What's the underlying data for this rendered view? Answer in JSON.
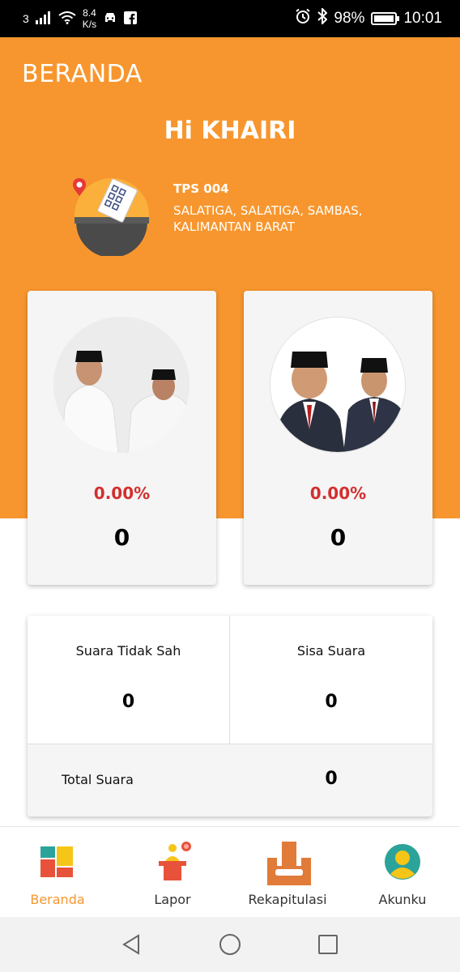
{
  "status_bar": {
    "network": "3",
    "speed_value": "8.4",
    "speed_unit": "K/s",
    "battery_level": "98%",
    "battery_fraction": 0.98,
    "time": "10:01",
    "icons": [
      "signal-icon",
      "wifi-icon",
      "car-icon",
      "facebook-icon",
      "alarm-icon",
      "bluetooth-icon",
      "battery-icon"
    ]
  },
  "header": {
    "title": "BERANDA",
    "greeting": "Hi KHAIRI",
    "tps_name": "TPS 004",
    "tps_location": "SALATIGA, SALATIGA, SAMBAS, KALIMANTAN BARAT",
    "background_color": "#F7962E"
  },
  "candidates": [
    {
      "percent": "0.00%",
      "votes": "0"
    },
    {
      "percent": "0.00%",
      "votes": "0"
    }
  ],
  "summary": {
    "invalid_label": "Suara Tidak Sah",
    "invalid_value": "0",
    "remaining_label": "Sisa Suara",
    "remaining_value": "0",
    "total_label": "Total Suara",
    "total_value": "0"
  },
  "nav": {
    "items": [
      {
        "label": "Beranda",
        "icon": "home-grid-icon",
        "active": true
      },
      {
        "label": "Lapor",
        "icon": "report-podium-icon",
        "active": false
      },
      {
        "label": "Rekapitulasi",
        "icon": "ballot-box-icon",
        "active": false
      },
      {
        "label": "Akunku",
        "icon": "account-icon",
        "active": false
      }
    ],
    "active_color": "#F7962E"
  },
  "system_nav": [
    "back-icon",
    "home-icon",
    "recents-icon"
  ]
}
